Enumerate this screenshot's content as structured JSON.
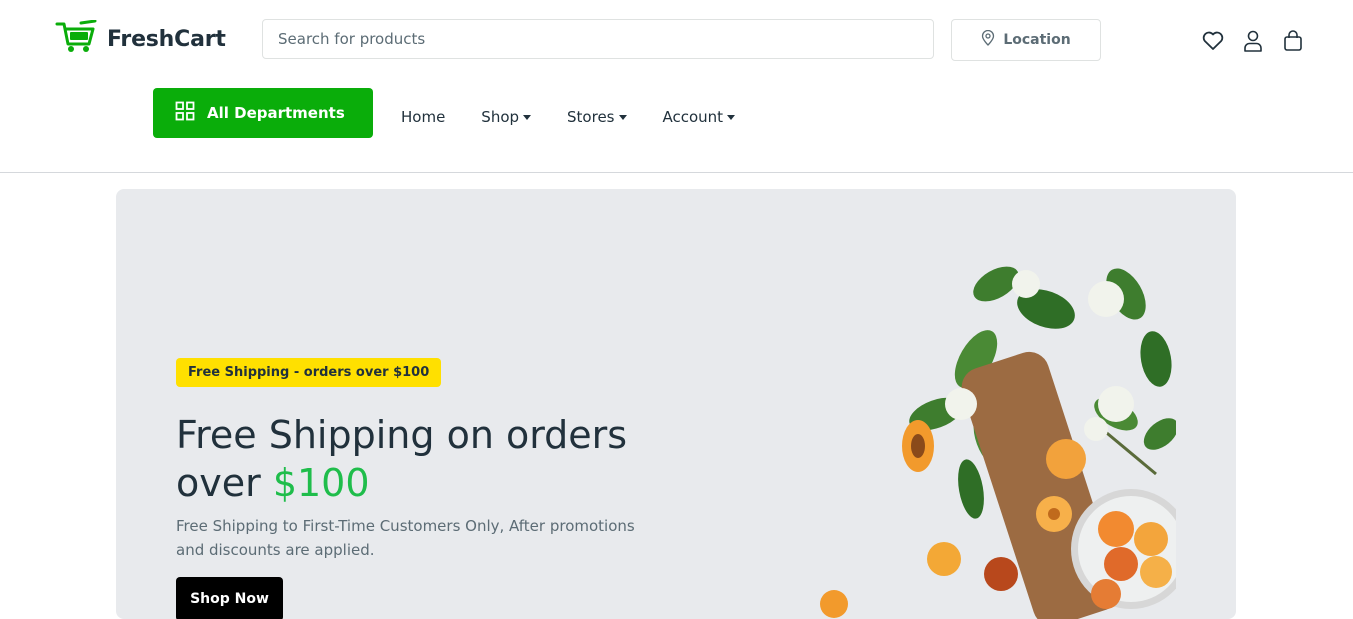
{
  "brand": {
    "name": "FreshCart",
    "color": "#0aad0a"
  },
  "search": {
    "placeholder": "Search for products"
  },
  "location": {
    "label": "Location",
    "icon": "map-pin-icon"
  },
  "header_icons": [
    "heart-icon",
    "user-icon",
    "shopping-bag-icon"
  ],
  "departments": {
    "label": "All Departments",
    "icon": "grid-icon"
  },
  "nav": {
    "items": [
      {
        "label": "Home",
        "dropdown": false
      },
      {
        "label": "Shop",
        "dropdown": true
      },
      {
        "label": "Stores",
        "dropdown": true
      },
      {
        "label": "Account",
        "dropdown": true
      }
    ]
  },
  "hero": {
    "badge": "Free Shipping - orders over $100",
    "title_line1": "Free Shipping on orders",
    "title_line2_prefix": "over ",
    "title_accent": "$100",
    "description": "Free Shipping to First-Time Customers Only, After promotions and discounts are applied.",
    "button": "Shop Now",
    "badge_color": "#ffe000",
    "accent_color": "#1fbd4b",
    "background": "#e8eaed"
  }
}
